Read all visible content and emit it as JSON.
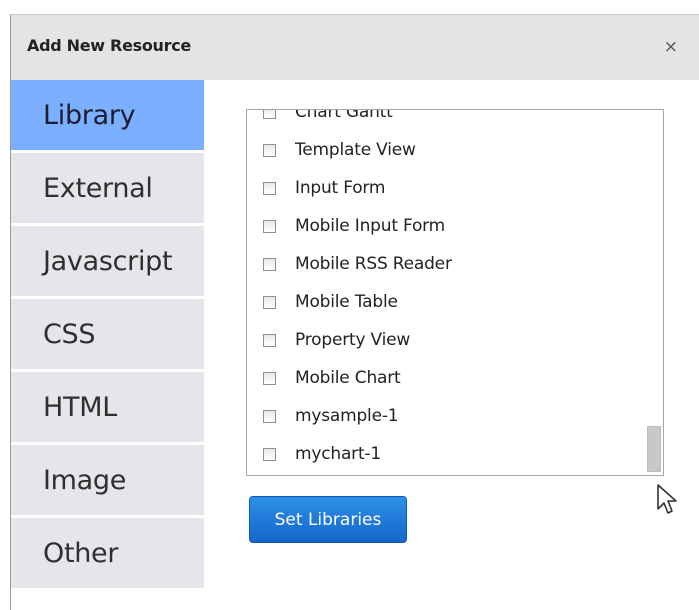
{
  "dialog": {
    "title": "Add New Resource",
    "close_symbol": "×"
  },
  "sidebar": {
    "tabs": [
      {
        "label": "Library",
        "active": true
      },
      {
        "label": "External",
        "active": false
      },
      {
        "label": "Javascript",
        "active": false
      },
      {
        "label": "CSS",
        "active": false
      },
      {
        "label": "HTML",
        "active": false
      },
      {
        "label": "Image",
        "active": false
      },
      {
        "label": "Other",
        "active": false
      }
    ]
  },
  "library": {
    "items": [
      {
        "label": "Chart Gantt",
        "checked": false
      },
      {
        "label": "Template View",
        "checked": false
      },
      {
        "label": "Input Form",
        "checked": false
      },
      {
        "label": "Mobile Input Form",
        "checked": false
      },
      {
        "label": "Mobile RSS Reader",
        "checked": false
      },
      {
        "label": "Mobile Table",
        "checked": false
      },
      {
        "label": "Property View",
        "checked": false
      },
      {
        "label": "Mobile Chart",
        "checked": false
      },
      {
        "label": "mysample-1",
        "checked": false
      },
      {
        "label": "mychart-1",
        "checked": false
      }
    ],
    "set_button_label": "Set Libraries"
  },
  "colors": {
    "active_tab": "#7ab0ff",
    "inactive_tab": "#e4e6ea",
    "titlebar": "#e4e4e4",
    "button_primary": "#1f7ad8"
  },
  "icons": {
    "close": "close-icon",
    "cursor": "mouse-pointer-icon",
    "checkbox": "checkbox-icon"
  }
}
